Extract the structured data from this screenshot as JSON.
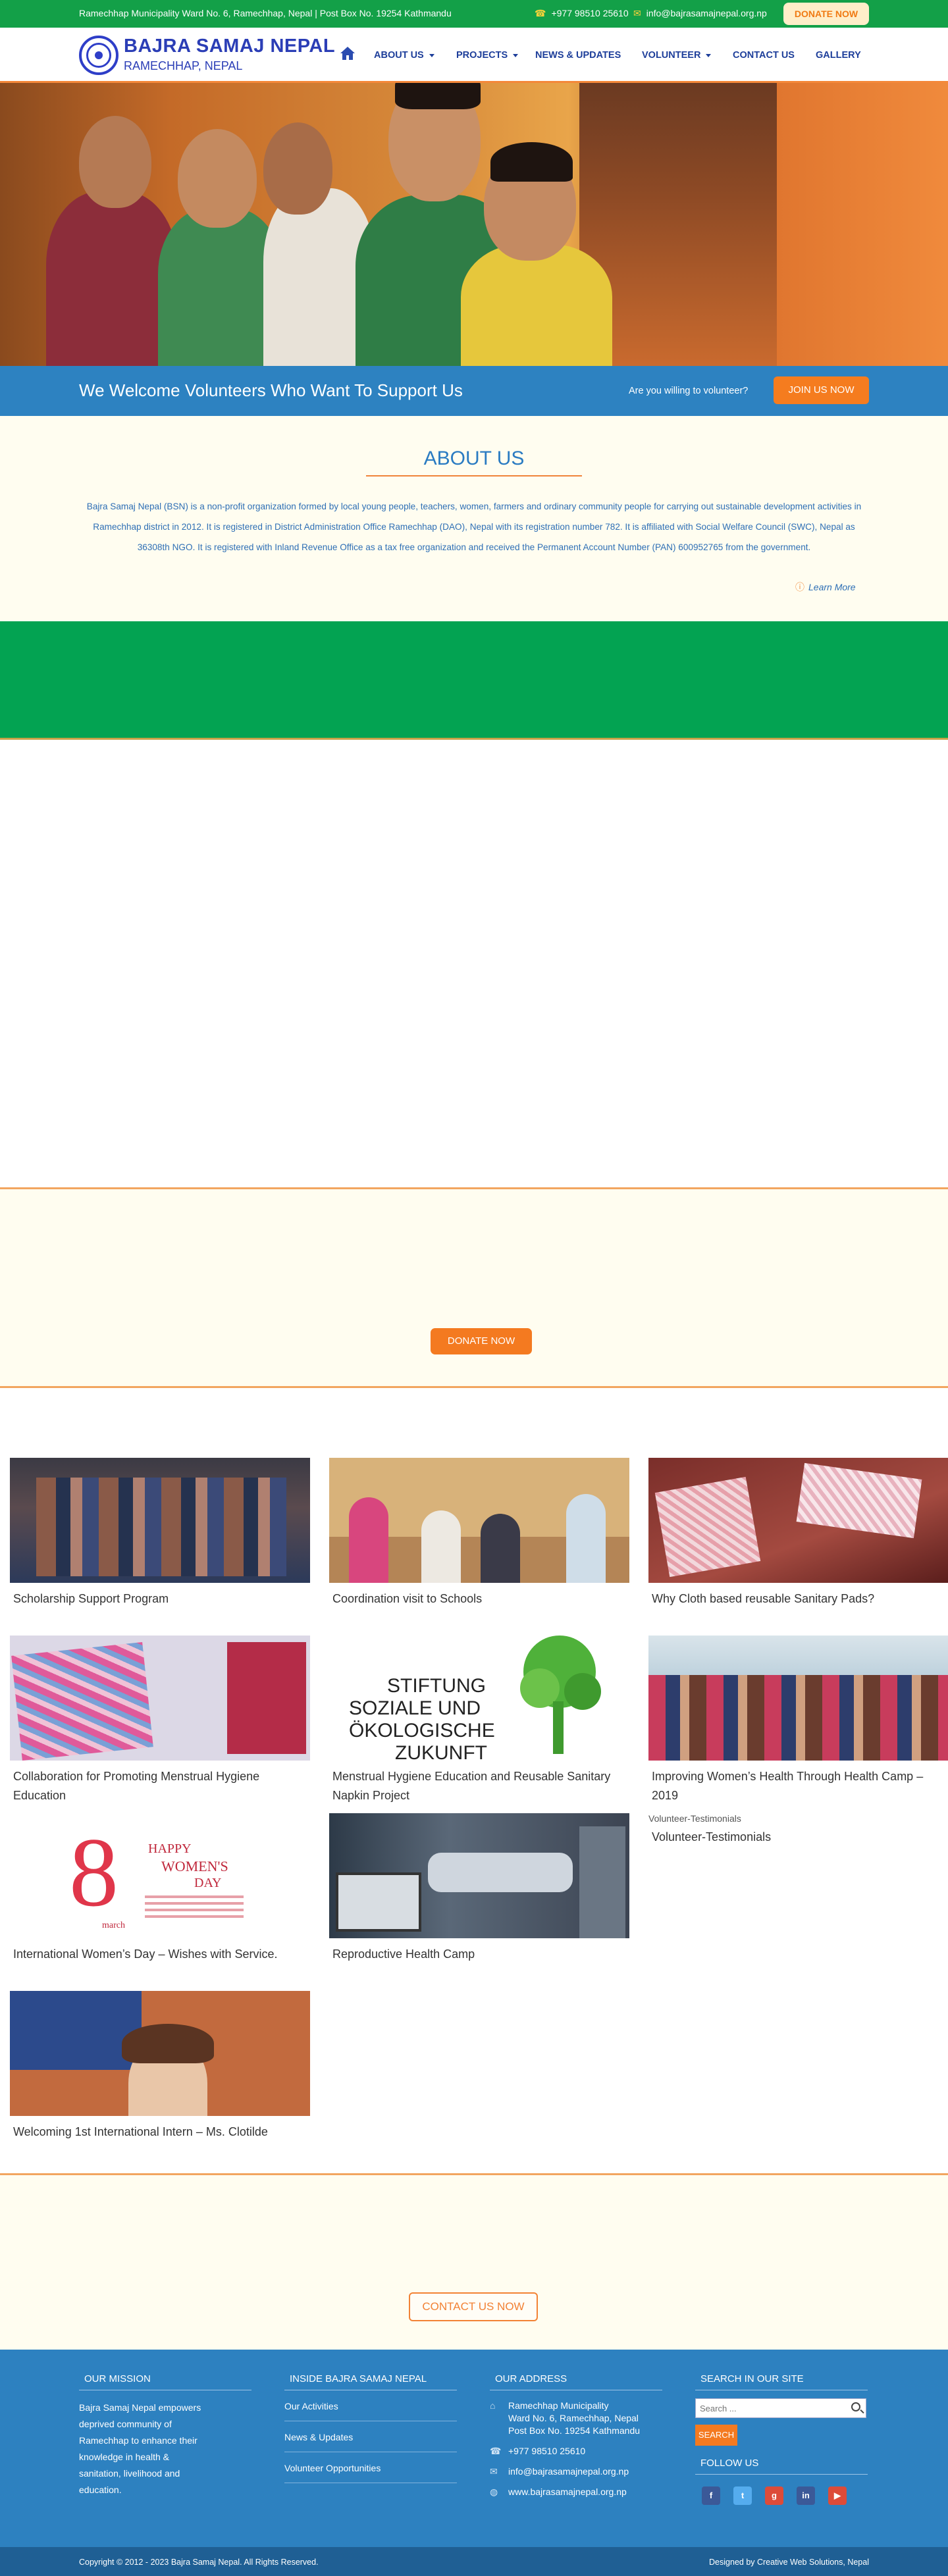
{
  "topbar": {
    "address": "Ramechhap Municipality Ward No. 6, Ramechhap, Nepal | Post Box No. 19254 Kathmandu",
    "phone": "+977 98510 25610",
    "email": "info@bajrasamajnepal.org.np",
    "donate_label": "DONATE NOW"
  },
  "header": {
    "org_name": "BAJRA SAMAJ NEPAL",
    "org_sub": "RAMECHHAP, NEPAL",
    "nav": [
      "ABOUT US",
      "PROJECTS",
      "NEWS & UPDATES",
      "VOLUNTEER",
      "CONTACT US",
      "GALLERY"
    ]
  },
  "welcome": {
    "text": "We Welcome Volunteers Who Want To Support Us",
    "question": "Are you willing to volunteer?",
    "join_label": "JOIN US NOW"
  },
  "about": {
    "title": "ABOUT US",
    "body": "Bajra Samaj Nepal (BSN) is a non-profit organization formed by local young people, teachers, women, farmers and ordinary community people for carrying out sustainable development activities in Ramechhap district in 2012. It is registered in District Administration Office Ramechhap (DAO), Nepal with its registration number 782. It is affiliated with Social Welfare Council (SWC), Nepal as 36308th NGO. It is registered with Inland Revenue Office as a tax free organization and received the Permanent Account Number (PAN) 600952765 from the government.",
    "learn_more": "Learn More"
  },
  "donate_band": {
    "label": "DONATE NOW"
  },
  "news": [
    {
      "caption": "Scholarship Support Program"
    },
    {
      "caption": "Coordination visit to Schools"
    },
    {
      "caption": "Why Cloth based reusable Sanitary Pads?"
    },
    {
      "caption": "Collaboration for Promoting Menstrual Hygiene Education"
    },
    {
      "caption": "Menstrual Hygiene Education and Reusable Sanitary Napkin Project"
    },
    {
      "caption": "Improving Women’s Health Through Health Camp – 2019"
    },
    {
      "caption": "International Women’s Day – Wishes with Service."
    },
    {
      "caption": "Reproductive Health Camp"
    },
    {
      "caption": "Volunteer-Testimonials"
    },
    {
      "caption": "Welcoming 1st International Intern – Ms. Clotilde"
    }
  ],
  "news_images": {
    "broken_alt": "Volunteer-Testimonials",
    "stiftung_text": [
      "STIFTUNG",
      "SOZIALE UND",
      "ÖKOLOGISCHE",
      "ZUKUNFT"
    ],
    "womens_day": {
      "num": "8",
      "line1": "HAPPY",
      "line2": "WOMEN'S",
      "line3": "DAY",
      "march": "march"
    }
  },
  "contact_band": {
    "label": "CONTACT US NOW"
  },
  "footer": {
    "mission_title": "OUR MISSION",
    "mission_text": "Bajra Samaj Nepal empowers deprived community of Ramechhap to enhance their knowledge in health & sanitation, livelihood and education.",
    "inside_title": "INSIDE BAJRA SAMAJ NEPAL",
    "inside_links": [
      "Our Activities",
      "News & Updates",
      "Volunteer Opportunities"
    ],
    "address_title": "OUR ADDRESS",
    "address_lines": [
      "Ramechhap Municipality",
      "Ward No. 6, Ramechhap, Nepal",
      "Post Box No. 19254 Kathmandu"
    ],
    "phone": "+977 98510 25610",
    "email": "info@bajrasamajnepal.org.np",
    "website": "www.bajrasamajnepal.org.np",
    "search_title": "SEARCH IN OUR SITE",
    "search_placeholder": "Search ...",
    "search_button": "SEARCH",
    "follow_title": "FOLLOW US",
    "social_colors": [
      "#3b5998",
      "#55acee",
      "#dd4b39",
      "#3b5998",
      "#dd4b39"
    ]
  },
  "copyright": {
    "left": "Copyright © 2012 - 2023 Bajra Samaj Nepal. All Rights Reserved.",
    "right": "Designed by Creative Web Solutions, Nepal"
  }
}
